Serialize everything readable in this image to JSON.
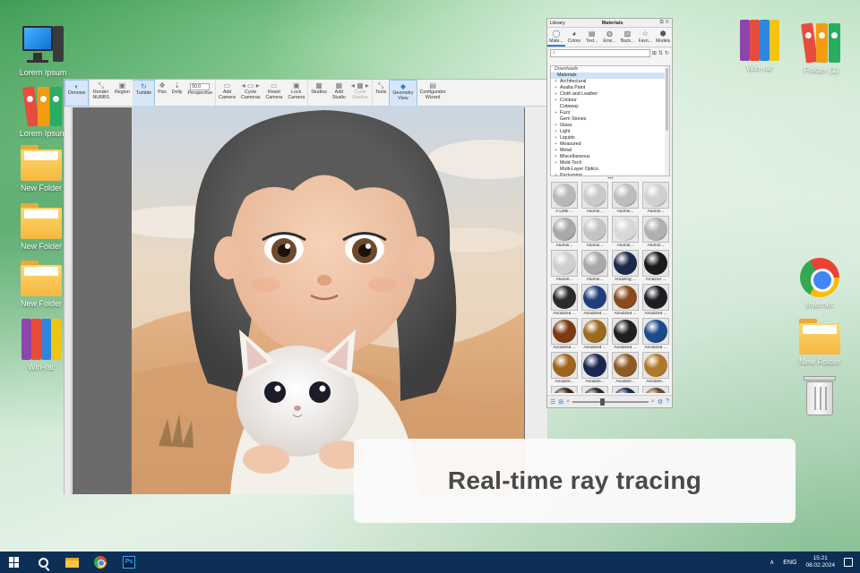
{
  "desktop": {
    "left_icons": [
      {
        "label": "Lorem Ipsum",
        "icon": "computer-icon"
      },
      {
        "label": "Lorem Ipsum",
        "icon": "binders-icon"
      },
      {
        "label": "New Folder",
        "icon": "folder-icon"
      },
      {
        "label": "New Folder",
        "icon": "folder-icon"
      },
      {
        "label": "New Folder",
        "icon": "folder-icon"
      },
      {
        "label": "Win-rar",
        "icon": "winrar-icon"
      }
    ],
    "right_icons": [
      {
        "label": "Win-rar",
        "icon": "winrar-icon"
      },
      {
        "label": "Folder (1)",
        "icon": "binders-icon"
      },
      {
        "label": "Internet",
        "icon": "chrome-icon"
      },
      {
        "label": "New Folder",
        "icon": "folder-icon"
      },
      {
        "label": "",
        "icon": "recycle-bin-icon"
      }
    ]
  },
  "app": {
    "toolbar": [
      {
        "l1": "Denoise",
        "l2": "",
        "active": true
      },
      {
        "l1": "Render",
        "l2": "NURBS"
      },
      {
        "l1": "Region",
        "l2": ""
      },
      {
        "l1": "Tumble",
        "l2": "",
        "active": true
      },
      {
        "l1": "Pan",
        "l2": ""
      },
      {
        "l1": "Dolly",
        "l2": ""
      },
      {
        "l1": "Perspective",
        "l2": "",
        "value": "50.0"
      },
      {
        "l1": "Add",
        "l2": "Camera"
      },
      {
        "l1": "Cycle",
        "l2": "Cameras"
      },
      {
        "l1": "Reset",
        "l2": "Camera"
      },
      {
        "l1": "Lock",
        "l2": "Camera"
      },
      {
        "l1": "Studios",
        "l2": ""
      },
      {
        "l1": "Add",
        "l2": "Studio"
      },
      {
        "l1": "Cycle",
        "l2": "Studios",
        "dim": true
      },
      {
        "l1": "Tools",
        "l2": ""
      },
      {
        "l1": "Geometry",
        "l2": "View",
        "active": true
      },
      {
        "l1": "Configurator",
        "l2": "Wizard"
      }
    ]
  },
  "library": {
    "label": "Library",
    "title": "Materials",
    "tabs": [
      {
        "label": "Mate...",
        "icon": "sphere-icon",
        "active": true
      },
      {
        "label": "Colors",
        "icon": "palette-icon"
      },
      {
        "label": "Text...",
        "icon": "texture-icon"
      },
      {
        "label": "Envi...",
        "icon": "environment-icon"
      },
      {
        "label": "Back...",
        "icon": "image-icon"
      },
      {
        "label": "Favo...",
        "icon": "star-icon"
      },
      {
        "label": "Models",
        "icon": "cube-icon"
      }
    ],
    "search_placeholder": "",
    "tree": [
      {
        "label": "Downloads",
        "level": "top"
      },
      {
        "label": "Materials",
        "level": "sel"
      },
      {
        "label": "Architectural",
        "plus": true
      },
      {
        "label": "Axalta Paint",
        "plus": true
      },
      {
        "label": "Cloth and Leather",
        "plus": true
      },
      {
        "label": "Contour",
        "plus": true
      },
      {
        "label": "Cutaway",
        "plus": false
      },
      {
        "label": "Fuzz",
        "plus": true
      },
      {
        "label": "Gem Stones",
        "plus": false
      },
      {
        "label": "Glass",
        "plus": true
      },
      {
        "label": "Light",
        "plus": true
      },
      {
        "label": "Liquids",
        "plus": true
      },
      {
        "label": "Measured",
        "plus": true
      },
      {
        "label": "Metal",
        "plus": true
      },
      {
        "label": "Miscellaneous",
        "plus": true
      },
      {
        "label": "Mold-Tech",
        "plus": true
      },
      {
        "label": "Multi-Layer Optics",
        "plus": false
      },
      {
        "label": "Packaging",
        "plus": true
      }
    ],
    "materials": [
      {
        "name": "A Little ...",
        "color": "#b8b8b8"
      },
      {
        "name": "Alumin...",
        "color": "#c9c9c9"
      },
      {
        "name": "Alumin...",
        "color": "#bdbdbd"
      },
      {
        "name": "Alumin...",
        "color": "#d0d0d0"
      },
      {
        "name": "Alumin...",
        "color": "#a9a9a9"
      },
      {
        "name": "Alumin...",
        "color": "#c4c4c4"
      },
      {
        "name": "Alumin...",
        "color": "#d8d8d8"
      },
      {
        "name": "Alumin...",
        "color": "#b0b0b0"
      },
      {
        "name": "Alumin...",
        "color": "#cfcfcf"
      },
      {
        "name": "Alumin...",
        "color": "#a8a8a8"
      },
      {
        "name": "Amazing ...",
        "color": "#1c2a4a"
      },
      {
        "name": "Amazon ...",
        "color": "#1a1a1a"
      },
      {
        "name": "Anodized ...",
        "color": "#2a2a2a"
      },
      {
        "name": "Anodized ...",
        "color": "#1f3f7a"
      },
      {
        "name": "Anodized ...",
        "color": "#8a4a1e"
      },
      {
        "name": "Anodized ...",
        "color": "#1d1d24"
      },
      {
        "name": "Anodized ...",
        "color": "#7a3a12"
      },
      {
        "name": "Anodized ...",
        "color": "#9a6a1e"
      },
      {
        "name": "Anodized ...",
        "color": "#202020"
      },
      {
        "name": "Anodized ...",
        "color": "#1c4a8a"
      },
      {
        "name": "Anodize...",
        "color": "#a0651c"
      },
      {
        "name": "Anodize...",
        "color": "#1a2550"
      },
      {
        "name": "Anodize...",
        "color": "#8c5a22"
      },
      {
        "name": "Anodize...",
        "color": "#b0782a"
      },
      {
        "name": "",
        "color": "#3a2a1a"
      },
      {
        "name": "",
        "color": "#2a2a2a"
      },
      {
        "name": "",
        "color": "#1e2a4a"
      },
      {
        "name": "",
        "color": "#6a4a2a"
      }
    ]
  },
  "caption": "Real-time ray tracing",
  "taskbar": {
    "apps": [
      "start-icon",
      "search-icon",
      "file-explorer-icon",
      "chrome-icon",
      "photoshop-icon"
    ],
    "ps_label": "Ps",
    "lang": "ENG",
    "time": "15:21",
    "date": "08.02.2024"
  }
}
